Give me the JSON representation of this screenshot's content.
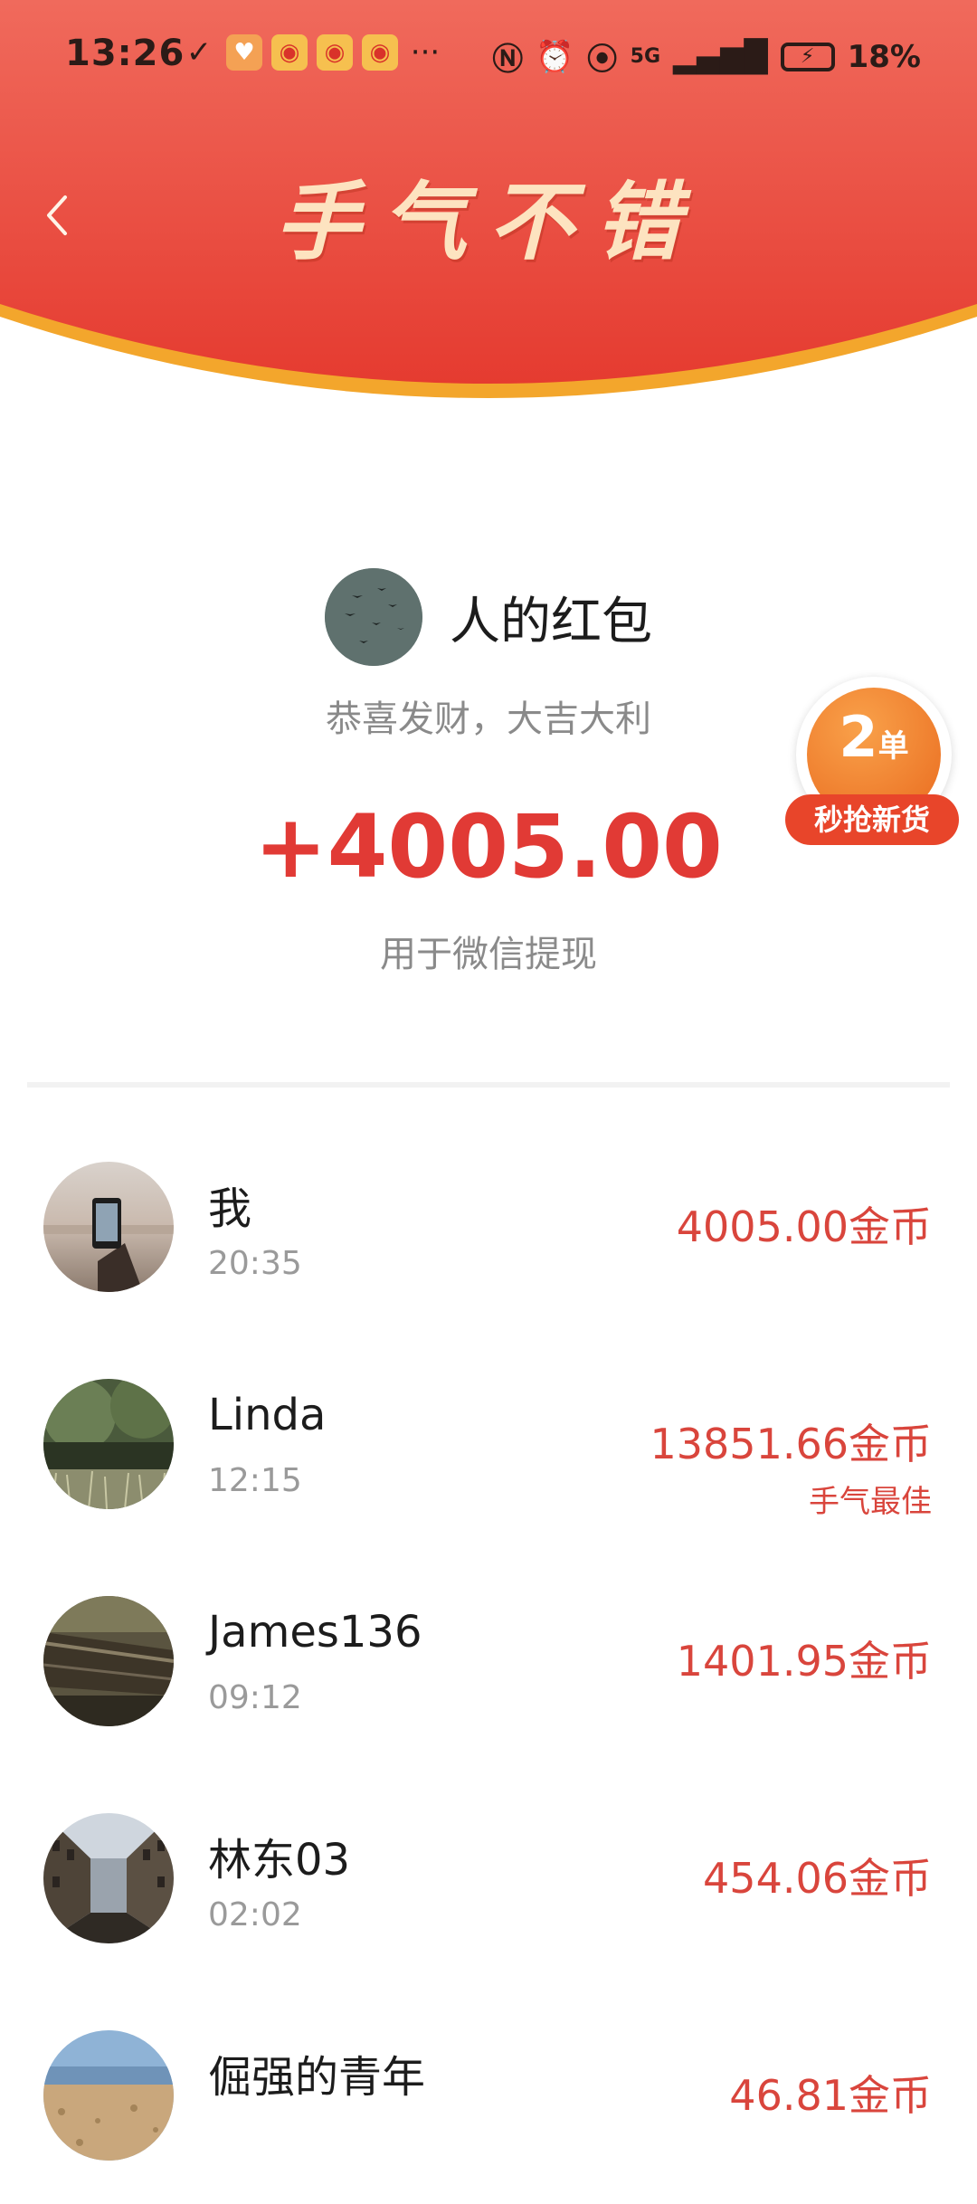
{
  "status_bar": {
    "time": "13:26",
    "more": "···",
    "network": "5G",
    "battery": "18%"
  },
  "header": {
    "title": "手气不错",
    "back_icon": "chevron-left-icon"
  },
  "packet": {
    "sender": "人的红包",
    "blessing": "恭喜发财，大吉大利",
    "amount": "+4005.00",
    "usage": "用于微信提现"
  },
  "promo": {
    "count": "2",
    "unit": "单",
    "label": "秒抢新货"
  },
  "records": [
    {
      "name": "我",
      "time": "20:35",
      "amount": "4005.00金币",
      "tag": ""
    },
    {
      "name": "Linda",
      "time": "12:15",
      "amount": "13851.66金币",
      "tag": "手气最佳"
    },
    {
      "name": "James136",
      "time": "09:12",
      "amount": "1401.95金币",
      "tag": ""
    },
    {
      "name": "林东03",
      "time": "02:02",
      "amount": "454.06金币",
      "tag": ""
    },
    {
      "name": "倔强的青年",
      "time": "",
      "amount": "46.81金币",
      "tag": ""
    }
  ],
  "colors": {
    "header_red": "#e8423a",
    "header_gold_rim": "#f3a62c",
    "amount_red": "#e13a35",
    "promo_orange": "#ef7a2a"
  }
}
